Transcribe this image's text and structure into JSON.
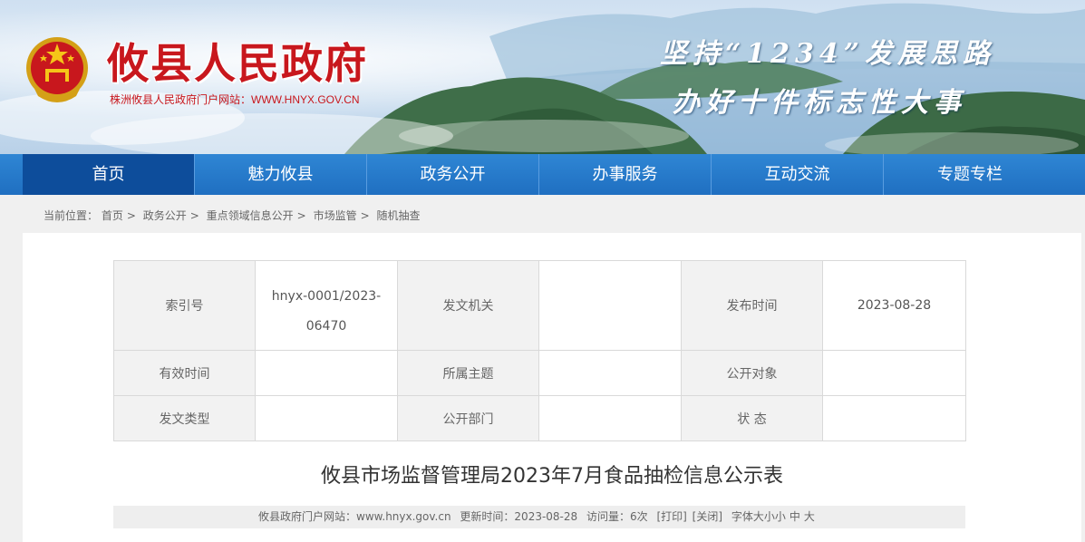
{
  "header": {
    "site_title": "攸县人民政府",
    "site_subtitle": "株洲攸县人民政府门户网站：WWW.HNYX.GOV.CN",
    "slogan_line1": "坚持“1234”发展思路",
    "slogan_line2": "办好十件标志性大事"
  },
  "nav": {
    "items": [
      {
        "label": "首页",
        "active": true
      },
      {
        "label": "魅力攸县"
      },
      {
        "label": "政务公开"
      },
      {
        "label": "办事服务"
      },
      {
        "label": "互动交流"
      },
      {
        "label": "专题专栏"
      }
    ]
  },
  "breadcrumb": {
    "prefix": "当前位置：",
    "items": [
      "首页",
      "政务公开",
      "重点领域信息公开",
      "市场监管",
      "随机抽查"
    ]
  },
  "meta_table": {
    "index_label": "索引号",
    "index_value_line1": "hnyx-0001/2023-",
    "index_value_line2": "06470",
    "issuer_label": "发文机关",
    "issuer_value": "",
    "publish_label": "发布时间",
    "publish_value": "2023-08-28",
    "valid_label": "有效时间",
    "valid_value": "",
    "topic_label": "所属主题",
    "topic_value": "",
    "audience_label": "公开对象",
    "audience_value": "",
    "doctype_label": "发文类型",
    "doctype_value": "",
    "dept_label": "公开部门",
    "dept_value": "",
    "status_label": "状 态",
    "status_value": ""
  },
  "article": {
    "title": "攸县市场监督管理局2023年7月食品抽检信息公示表"
  },
  "info_bar": {
    "source": "攸县政府门户网站：www.hnyx.gov.cn",
    "updated": "更新时间：2023-08-28",
    "visits": "访问量：6次",
    "print": "[打印]",
    "close": "[关闭]",
    "font_size_label": "字体大小",
    "font_small": "小",
    "font_medium": "中",
    "font_large": "大"
  },
  "colors": {
    "brand_red": "#c8171d",
    "nav_blue": "#1f6fc1",
    "nav_active": "#0d4d9b"
  }
}
